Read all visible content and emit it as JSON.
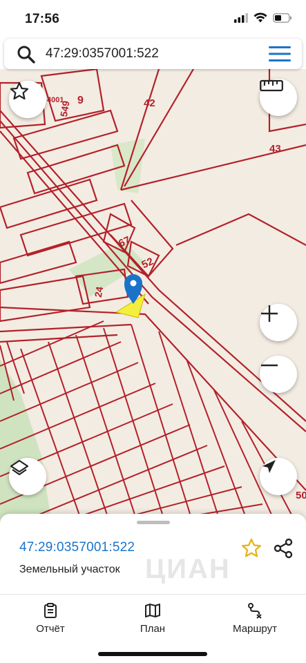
{
  "status_bar": {
    "time": "17:56"
  },
  "search": {
    "value": "47:29:0357001:522",
    "placeholder": ""
  },
  "map": {
    "labels": {
      "lbl_4001": "4001",
      "lbl_549": "549",
      "lbl_9": "9",
      "lbl_42": "42",
      "lbl_43": "43",
      "lbl_67": "67",
      "lbl_52": "52",
      "lbl_24": "24",
      "lbl_50": "50"
    },
    "colors": {
      "parcel_line": "#b3202a",
      "background": "#f3ece2",
      "green": "#cfe3c0",
      "selected_parcel": "#f4ef3c",
      "pin": "#1a73c9"
    }
  },
  "controls": {
    "favorite_icon": "star-outline-icon",
    "ruler_icon": "ruler-icon",
    "zoom_in_icon": "plus-icon",
    "zoom_out_icon": "minus-icon",
    "layers_icon": "layers-icon",
    "locate_icon": "navigation-arrow-icon"
  },
  "sheet": {
    "parcel_id": "47:29:0357001:522",
    "parcel_type": "Земельный участок",
    "watermark": "ЦИАН",
    "favorite_color": "#e6b61c"
  },
  "tabs": [
    {
      "label": "Отчёт",
      "icon": "report-clipboard-icon"
    },
    {
      "label": "План",
      "icon": "map-plan-icon"
    },
    {
      "label": "Маршрут",
      "icon": "route-icon"
    }
  ]
}
